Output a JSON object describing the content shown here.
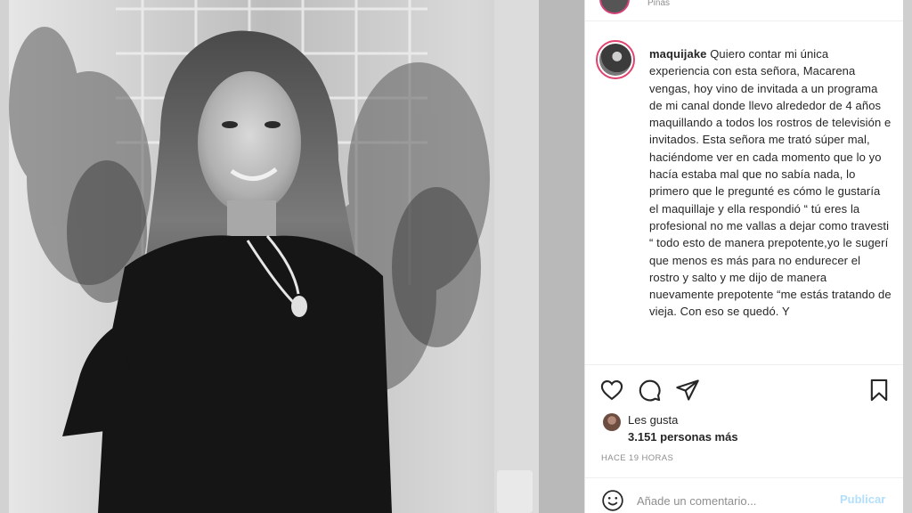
{
  "post": {
    "top_subtitle": "Pinas",
    "username": "maquijake",
    "caption": "Quiero contar mi única experiencia con esta señora, Macarena vengas, hoy vino de invitada a un programa de mi canal donde llevo alrededor de 4 años maquillando a todos los rostros de televisión e invitados. Esta señora me trató súper mal, haciéndome ver en cada momento que lo yo hacía estaba mal que no sabía nada, lo primero que le pregunté es cómo le gustaría el maquillaje y ella respondió “ tú eres la profesional no me vallas a dejar como travesti “ todo esto de manera prepotente,yo le sugerí que menos es más para no endurecer el rostro y salto y me dijo de manera nuevamente prepotente “me estás tratando de vieja. Con eso se quedó. Y",
    "likes_label": "Les gusta",
    "likes_count": "3.151 personas más",
    "time_ago": "HACE 19 HORAS"
  },
  "actions": {
    "icons": [
      "heart-icon",
      "comment-icon",
      "share-icon",
      "bookmark-icon"
    ]
  },
  "comment": {
    "placeholder": "Añade un comentario...",
    "publish_label": "Publicar",
    "emoji_icon": "emoji-icon"
  },
  "colors": {
    "publish_disabled": "#b2dffc",
    "avatar_ring": "#e0436f",
    "text": "#262626",
    "muted": "#8e8e8e"
  }
}
